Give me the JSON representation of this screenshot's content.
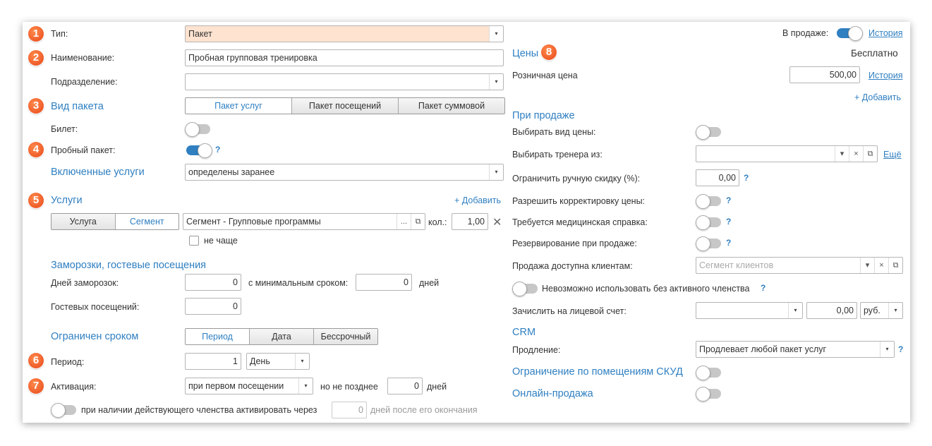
{
  "left": {
    "type": {
      "label": "Тип:",
      "value": "Пакет"
    },
    "name": {
      "label": "Наименование:",
      "value": "Пробная групповая тренировка"
    },
    "division": {
      "label": "Подразделение:",
      "value": ""
    },
    "package_kind": {
      "label": "Вид пакета",
      "options": [
        "Пакет услуг",
        "Пакет посещений",
        "Пакет суммовой"
      ]
    },
    "ticket": {
      "label": "Билет:"
    },
    "trial": {
      "label": "Пробный пакет:",
      "help": "?"
    },
    "included": {
      "label": "Включенные услуги",
      "value": "определены заранее"
    },
    "services": {
      "label": "Услуги",
      "add": "+ Добавить",
      "mode_options": [
        "Услуга",
        "Сегмент"
      ],
      "value": "Сегмент - Групповые программы",
      "more": "...",
      "qty_label": "кол.:",
      "qty": "1,00",
      "remove": "✕",
      "not_more_often": "не чаще"
    },
    "freeze": {
      "title": "Заморозки, гостевые посещения",
      "days_label": "Дней заморозок:",
      "days": "0",
      "min_term_label": "с минимальным сроком:",
      "min_term": "0",
      "days_unit": "дней",
      "guest_label": "Гостевых посещений:",
      "guest": "0"
    },
    "limited": {
      "label": "Ограничен сроком",
      "options": [
        "Период",
        "Дата",
        "Бессрочный"
      ]
    },
    "period": {
      "label": "Период:",
      "value": "1",
      "unit": "День"
    },
    "activation": {
      "label": "Активация:",
      "value": "при первом посещении",
      "not_later_label": "но не позднее",
      "not_later": "0",
      "days_unit": "дней"
    },
    "membership_activation": {
      "label": "при наличии действующего членства активировать через",
      "value": "0",
      "suffix": "дней после его окончания"
    }
  },
  "right": {
    "on_sale": {
      "label": "В продаже:",
      "history": "История"
    },
    "prices": {
      "title": "Цены",
      "free": "Бесплатно",
      "retail_label": "Розничная цена",
      "retail": "500,00",
      "history": "История",
      "add": "+ Добавить"
    },
    "on_sale_section": "При продаже",
    "choose_price_kind": "Выбирать вид цены:",
    "choose_trainer": {
      "label": "Выбирать тренера из:",
      "more": "Ещё"
    },
    "manual_discount": {
      "label": "Ограничить ручную скидку (%):",
      "value": "0,00",
      "help": "?"
    },
    "allow_price_edit": {
      "label": "Разрешить корректировку цены:",
      "help": "?"
    },
    "medical": {
      "label": "Требуется медицинская справка:",
      "help": "?"
    },
    "reserve": {
      "label": "Резервирование при продаже:",
      "help": "?"
    },
    "available_to": {
      "label": "Продажа доступна клиентам:",
      "placeholder": "Сегмент клиентов"
    },
    "membership_required": {
      "label": "Невозможно использовать без активного членства",
      "help": "?"
    },
    "account": {
      "label": "Зачислить на лицевой счет:",
      "amount": "0,00",
      "currency": "руб."
    },
    "crm": {
      "title": "CRM",
      "prolong_label": "Продление:",
      "prolong_value": "Продлевает любой пакет услуг",
      "help": "?"
    },
    "skud": "Ограничение по помещениям СКУД",
    "online": "Онлайн-продажа"
  },
  "badges": [
    "1",
    "2",
    "3",
    "4",
    "5",
    "6",
    "7",
    "8"
  ],
  "icons": {
    "dropdown": "▾",
    "open": "⧉",
    "clear": "×"
  },
  "colors": {
    "accent": "#2f7fc1",
    "badge": "#e8481a",
    "type_field": "#fde3d0"
  }
}
